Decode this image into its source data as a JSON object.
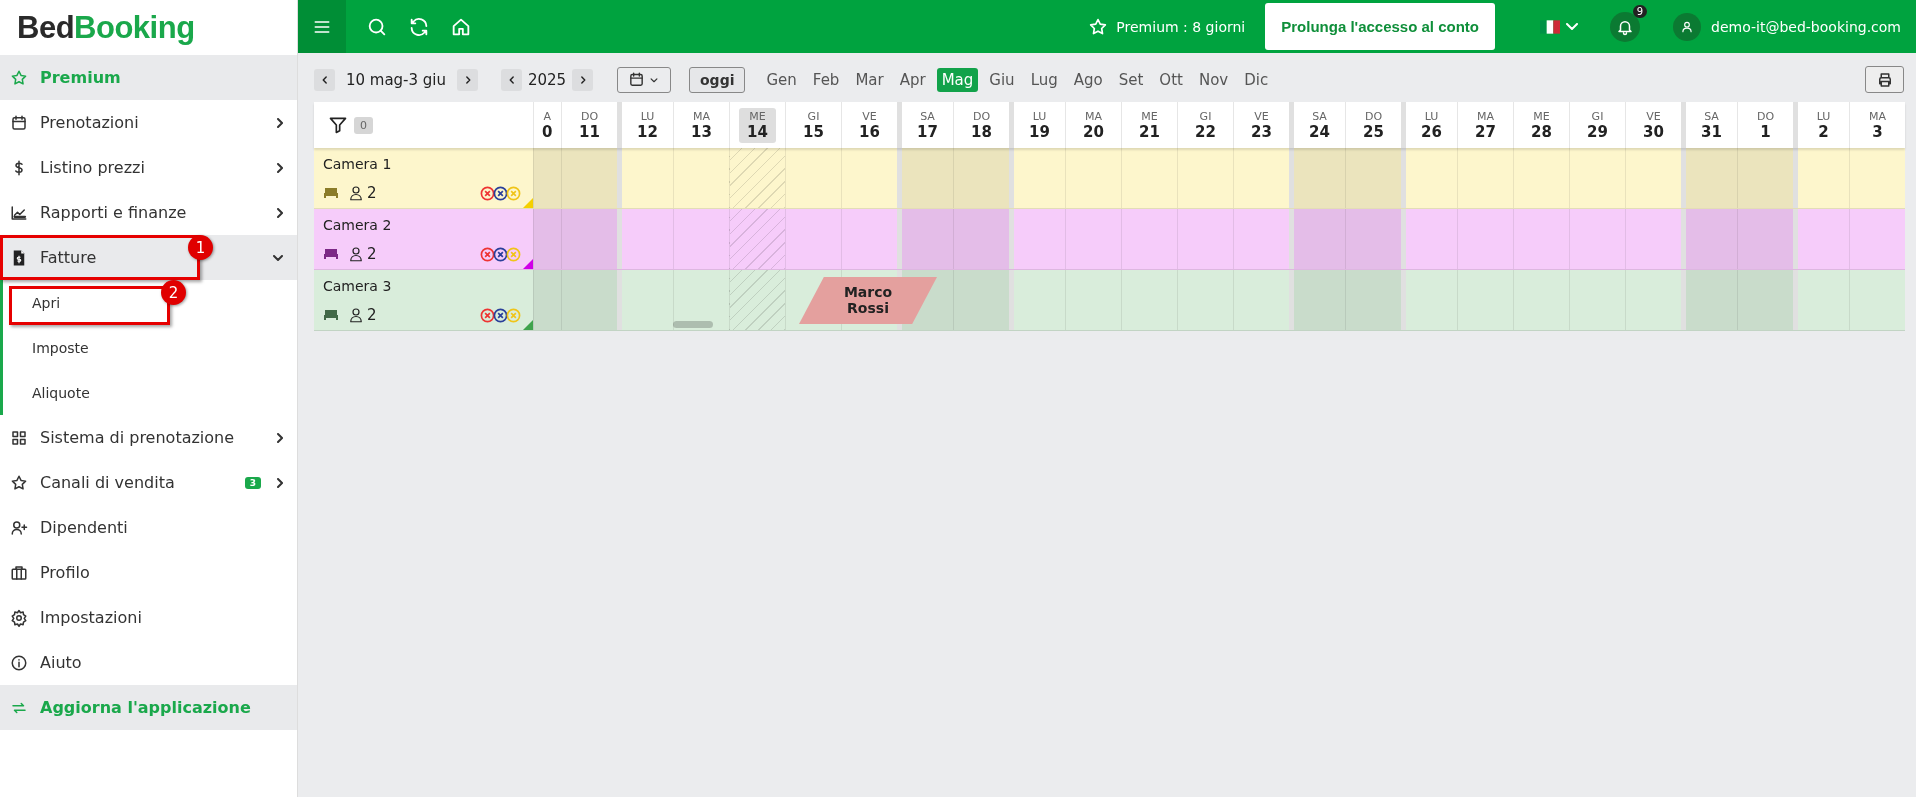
{
  "topbar": {
    "premium": "Premium : 8 giorni",
    "extend_button": "Prolunga l'accesso al conto",
    "notifications": "9",
    "user": "demo-it@bed-booking.com"
  },
  "sidebar": {
    "logo": {
      "dark": "Bed",
      "green": "Booking"
    },
    "items": [
      {
        "kind": "highlight",
        "label": "Premium",
        "has_submenu": false
      },
      {
        "kind": "item",
        "label": "Prenotazioni",
        "has_submenu": true,
        "expanded": false
      },
      {
        "kind": "item",
        "label": "Listino prezzi",
        "has_submenu": true,
        "expanded": false
      },
      {
        "kind": "item",
        "label": "Rapporti e finanze",
        "has_submenu": true,
        "expanded": false
      },
      {
        "kind": "item",
        "label": "Fatture",
        "has_submenu": true,
        "expanded": true,
        "callout": "1",
        "children": [
          {
            "label": "Apri",
            "callout": "2"
          },
          {
            "label": "Imposte"
          },
          {
            "label": "Aliquote"
          }
        ]
      },
      {
        "kind": "item",
        "label": "Sistema di prenotazione",
        "has_submenu": true,
        "expanded": false
      },
      {
        "kind": "item",
        "label": "Canali di vendita",
        "has_submenu": true,
        "expanded": false,
        "badge": "3"
      },
      {
        "kind": "item",
        "label": "Dipendenti",
        "has_submenu": false,
        "expanded": false
      },
      {
        "kind": "item",
        "label": "Profilo",
        "has_submenu": false,
        "expanded": false
      },
      {
        "kind": "item",
        "label": "Impostazioni",
        "has_submenu": false,
        "expanded": false
      },
      {
        "kind": "item",
        "label": "Aiuto",
        "has_submenu": false,
        "expanded": false
      },
      {
        "kind": "highlight",
        "label": "Aggiorna l'applicazione",
        "has_submenu": false
      }
    ]
  },
  "calendar": {
    "range": "10 mag-3 giu",
    "year": "2025",
    "today_button": "oggi",
    "months": [
      {
        "label": "Gen",
        "selected": false
      },
      {
        "label": "Feb",
        "selected": false
      },
      {
        "label": "Mar",
        "selected": false
      },
      {
        "label": "Apr",
        "selected": false
      },
      {
        "label": "Mag",
        "selected": true
      },
      {
        "label": "Giu",
        "selected": false
      },
      {
        "label": "Lug",
        "selected": false
      },
      {
        "label": "Ago",
        "selected": false
      },
      {
        "label": "Set",
        "selected": false
      },
      {
        "label": "Ott",
        "selected": false
      },
      {
        "label": "Nov",
        "selected": false
      },
      {
        "label": "Dic",
        "selected": false
      }
    ],
    "filter_count": "0",
    "days": [
      {
        "weekday": "A",
        "day": "0",
        "weekend": true,
        "today": false,
        "cut": true
      },
      {
        "weekday": "DO",
        "day": "11",
        "weekend": true,
        "today": false,
        "cut": false
      },
      {
        "weekday": "LU",
        "day": "12",
        "weekend": false,
        "today": false,
        "cut": false
      },
      {
        "weekday": "MA",
        "day": "13",
        "weekend": false,
        "today": false,
        "cut": false
      },
      {
        "weekday": "ME",
        "day": "14",
        "weekend": false,
        "today": true,
        "cut": false
      },
      {
        "weekday": "GI",
        "day": "15",
        "weekend": false,
        "today": false,
        "cut": false
      },
      {
        "weekday": "VE",
        "day": "16",
        "weekend": false,
        "today": false,
        "cut": false
      },
      {
        "weekday": "SA",
        "day": "17",
        "weekend": true,
        "today": false,
        "cut": false
      },
      {
        "weekday": "DO",
        "day": "18",
        "weekend": true,
        "today": false,
        "cut": false
      },
      {
        "weekday": "LU",
        "day": "19",
        "weekend": false,
        "today": false,
        "cut": false
      },
      {
        "weekday": "MA",
        "day": "20",
        "weekend": false,
        "today": false,
        "cut": false
      },
      {
        "weekday": "ME",
        "day": "21",
        "weekend": false,
        "today": false,
        "cut": false
      },
      {
        "weekday": "GI",
        "day": "22",
        "weekend": false,
        "today": false,
        "cut": false
      },
      {
        "weekday": "VE",
        "day": "23",
        "weekend": false,
        "today": false,
        "cut": false
      },
      {
        "weekday": "SA",
        "day": "24",
        "weekend": true,
        "today": false,
        "cut": false
      },
      {
        "weekday": "DO",
        "day": "25",
        "weekend": true,
        "today": false,
        "cut": false
      },
      {
        "weekday": "LU",
        "day": "26",
        "weekend": false,
        "today": false,
        "cut": false
      },
      {
        "weekday": "MA",
        "day": "27",
        "weekend": false,
        "today": false,
        "cut": false
      },
      {
        "weekday": "ME",
        "day": "28",
        "weekend": false,
        "today": false,
        "cut": false
      },
      {
        "weekday": "GI",
        "day": "29",
        "weekend": false,
        "today": false,
        "cut": false
      },
      {
        "weekday": "VE",
        "day": "30",
        "weekend": false,
        "today": false,
        "cut": false
      },
      {
        "weekday": "SA",
        "day": "31",
        "weekend": true,
        "today": false,
        "cut": false
      },
      {
        "weekday": "DO",
        "day": "1",
        "weekend": true,
        "today": false,
        "cut": false
      },
      {
        "weekday": "LU",
        "day": "2",
        "weekend": false,
        "today": false,
        "cut": false
      },
      {
        "weekday": "MA",
        "day": "3",
        "weekend": false,
        "today": false,
        "cut": false
      }
    ],
    "rooms": [
      {
        "name": "Camera 1",
        "guests": "2",
        "color": "#f5d000"
      },
      {
        "name": "Camera 2",
        "guests": "2",
        "color": "#d000e8"
      },
      {
        "name": "Camera 3",
        "guests": "2",
        "color": "#3fa34d",
        "bookings": [
          {
            "guest": "Marco Rossi"
          }
        ]
      }
    ]
  }
}
